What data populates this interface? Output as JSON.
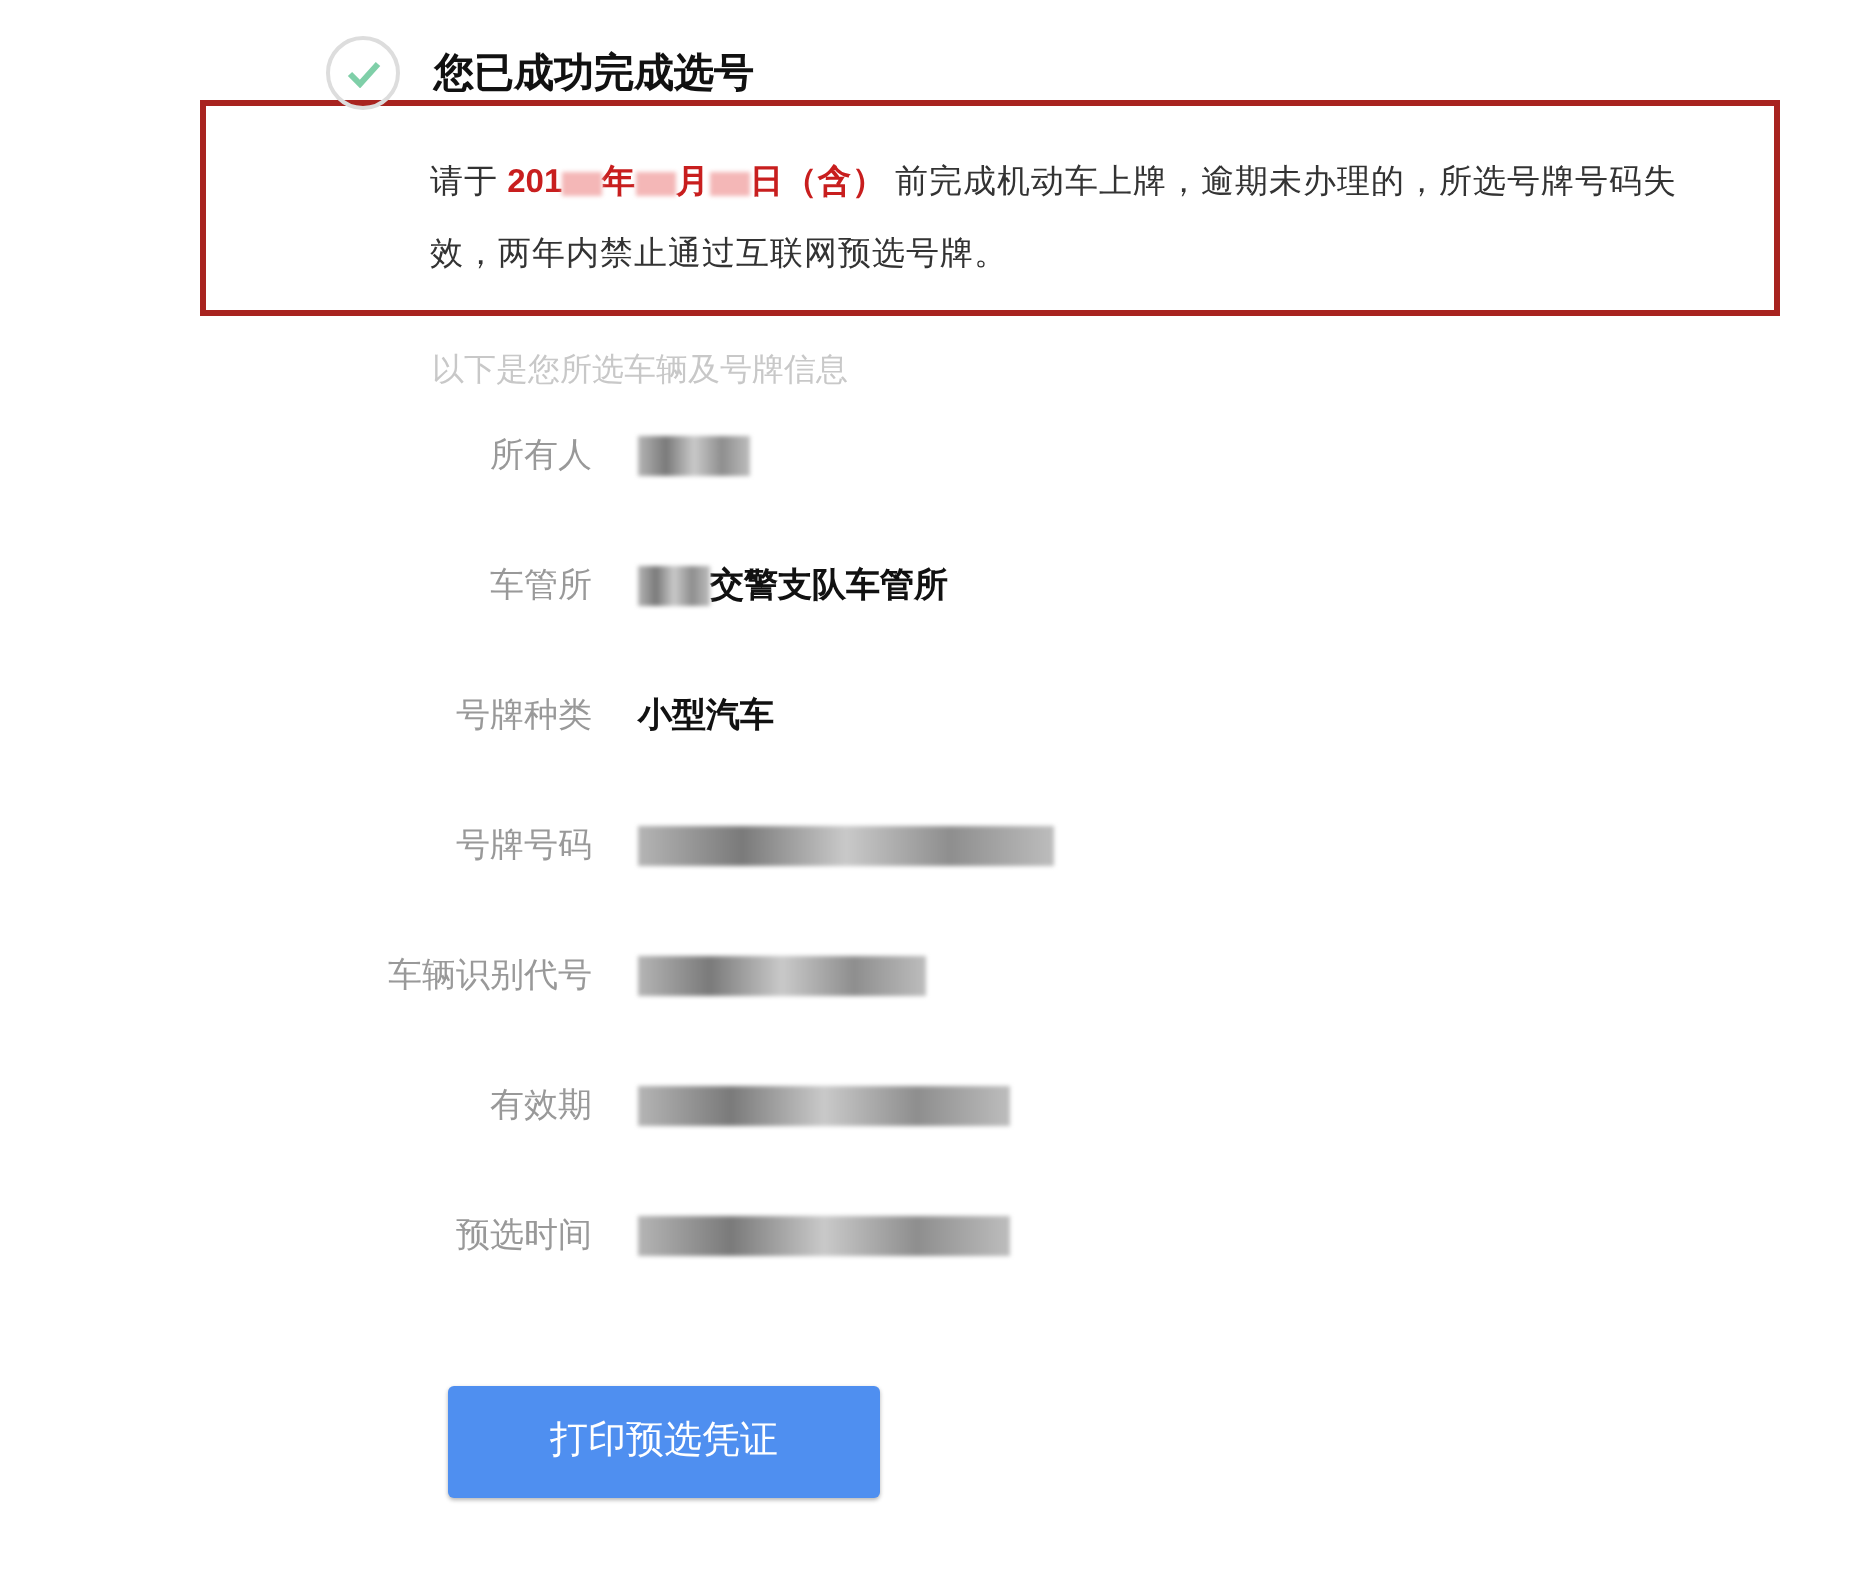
{
  "result": {
    "title": "您已成功完成选号",
    "checked": true
  },
  "notice": {
    "segments": [
      {
        "kind": "text",
        "text": "请于 "
      },
      {
        "kind": "highlight",
        "text": "201"
      },
      {
        "kind": "redacted"
      },
      {
        "kind": "highlight",
        "text": "年"
      },
      {
        "kind": "redacted"
      },
      {
        "kind": "highlight",
        "text": "月"
      },
      {
        "kind": "redacted"
      },
      {
        "kind": "highlight",
        "text": "日（含）"
      },
      {
        "kind": "text",
        "text": " 前完成机动车上牌，逾期未办理的，所选号牌号码失效，两年内禁止通过互联网预选号牌。"
      }
    ]
  },
  "subtitle": "以下是您所选车辆及号牌信息",
  "rows": [
    {
      "label": "所有人",
      "value": [
        {
          "kind": "redacted"
        }
      ]
    },
    {
      "label": "车管所",
      "value": [
        {
          "kind": "redacted"
        },
        {
          "kind": "text",
          "text": "交警支队车管所"
        }
      ]
    },
    {
      "label": "号牌种类",
      "value": [
        {
          "kind": "text",
          "text": "小型汽车"
        }
      ]
    },
    {
      "label": "号牌号码",
      "value": [
        {
          "kind": "redacted"
        }
      ]
    },
    {
      "label": "车辆识别代号",
      "value": [
        {
          "kind": "redacted"
        }
      ]
    },
    {
      "label": "有效期",
      "value": [
        {
          "kind": "redacted"
        }
      ]
    },
    {
      "label": "预选时间",
      "value": [
        {
          "kind": "redacted"
        }
      ]
    }
  ],
  "print_button": "打印预选凭证"
}
